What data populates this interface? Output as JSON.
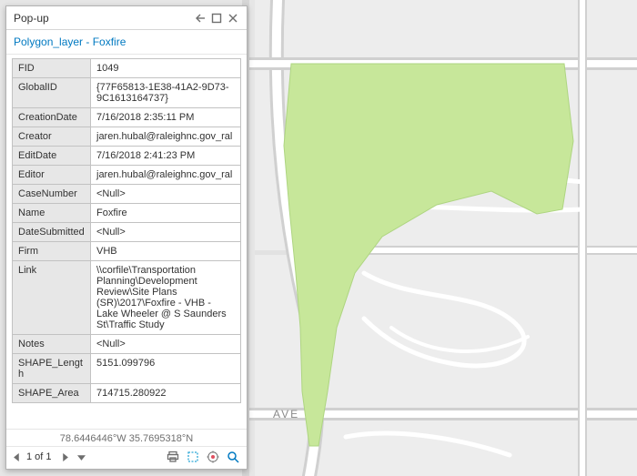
{
  "popup": {
    "title": "Pop-up",
    "subtitle": "Polygon_layer - Foxfire",
    "attributes": [
      {
        "key": "FID",
        "value": "1049"
      },
      {
        "key": "GlobalID",
        "value": "{77F65813-1E38-41A2-9D73-9C1613164737}"
      },
      {
        "key": "CreationDate",
        "value": "7/16/2018 2:35:11 PM"
      },
      {
        "key": "Creator",
        "value": "jaren.hubal@raleighnc.gov_ral"
      },
      {
        "key": "EditDate",
        "value": "7/16/2018 2:41:23 PM"
      },
      {
        "key": "Editor",
        "value": "jaren.hubal@raleighnc.gov_ral"
      },
      {
        "key": "CaseNumber",
        "value": "<Null>"
      },
      {
        "key": "Name",
        "value": "Foxfire"
      },
      {
        "key": "DateSubmitted",
        "value": "<Null>"
      },
      {
        "key": "Firm",
        "value": "VHB"
      },
      {
        "key": "Link",
        "value": "\\\\corfile\\Transportation Planning\\Development Review\\Site Plans (SR)\\2017\\Foxfire - VHB - Lake Wheeler @ S Saunders St\\Traffic Study"
      },
      {
        "key": "Notes",
        "value": "<Null>"
      },
      {
        "key": "SHAPE_Length",
        "value": "5151.099796"
      },
      {
        "key": "SHAPE_Area",
        "value": "714715.280922"
      }
    ],
    "coords": "78.6446446°W 35.7695318°N",
    "footer": {
      "prev": "◂",
      "counter": "1 of 1",
      "next": "▸",
      "menu": "▾"
    }
  },
  "map": {
    "label_ave": "AVE",
    "polygon_fill": "#c7e79a",
    "polygon_stroke": "#aed581",
    "road_color": "#ffffff",
    "road_edge": "#d0d0d0",
    "bg": "#e2e2e2",
    "block": "#ededed"
  }
}
